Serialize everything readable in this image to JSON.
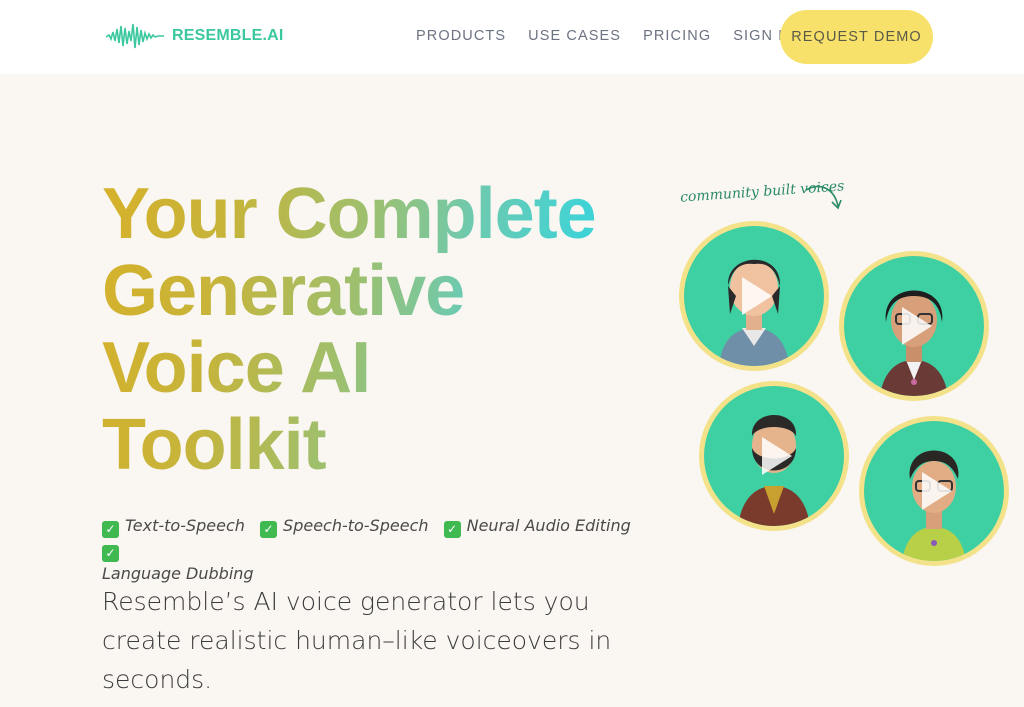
{
  "brand": {
    "name": "RESEMBLE.AI",
    "accent": "#3cc89f"
  },
  "nav": {
    "links": [
      "PRODUCTS",
      "USE CASES",
      "PRICING",
      "SIGN IN"
    ],
    "cta": "REQUEST DEMO"
  },
  "hero": {
    "title_lines": [
      "Your Complete",
      "Generative",
      "Voice AI",
      "Toolkit"
    ],
    "features": [
      "Text-to-Speech",
      "Speech-to-Speech",
      "Neural Audio Editing",
      "Language Dubbing"
    ],
    "subtitle": "Resemble’s AI voice generator lets you create realistic human–like voiceovers in seconds."
  },
  "voices": {
    "label": "community built voices",
    "avatars": [
      {
        "name": "avatar-voice-1",
        "icon": "play-icon"
      },
      {
        "name": "avatar-voice-2",
        "icon": "play-icon"
      },
      {
        "name": "avatar-voice-3",
        "icon": "play-icon"
      },
      {
        "name": "avatar-voice-4",
        "icon": "play-icon"
      }
    ]
  },
  "colors": {
    "nav_bg": "#ffffff",
    "page_bg": "#faf6f2",
    "cta_bg": "#f7e16a",
    "avatar_bg": "#3ecfa2",
    "avatar_ring": "#f3e28a",
    "gradient_start": "#d6b12a",
    "gradient_end": "#3fd3d6"
  }
}
